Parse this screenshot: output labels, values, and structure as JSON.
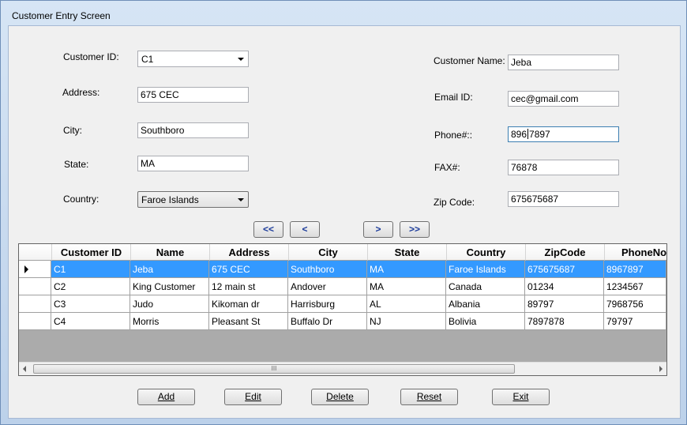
{
  "window": {
    "title": "Customer Entry Screen"
  },
  "form": {
    "customer_id": {
      "label": "Customer ID:",
      "value": "C1"
    },
    "address": {
      "label": "Address:",
      "value": "675 CEC"
    },
    "city": {
      "label": "City:",
      "value": "Southboro"
    },
    "state": {
      "label": "State:",
      "value": "MA"
    },
    "country": {
      "label": "Country:",
      "value": "Faroe Islands"
    },
    "customer_name": {
      "label": "Customer Name:",
      "value": "Jeba"
    },
    "email": {
      "label": "Email ID:",
      "value": "cec@gmail.com"
    },
    "phone": {
      "label": "Phone#::",
      "value_before_caret": "896",
      "value_after_caret": "7897"
    },
    "fax": {
      "label": "FAX#:",
      "value": "76878"
    },
    "zip": {
      "label": "Zip Code:",
      "value": "675675687"
    }
  },
  "nav": {
    "first": "<<",
    "prev": "<",
    "next": ">",
    "last": ">>"
  },
  "grid": {
    "columns": [
      "Customer ID",
      "Name",
      "Address",
      "City",
      "State",
      "Country",
      "ZipCode",
      "PhoneNo"
    ],
    "rows": [
      [
        "C1",
        "Jeba",
        "675 CEC",
        "Southboro",
        "MA",
        "Faroe Islands",
        "675675687",
        "8967897"
      ],
      [
        "C2",
        "King Customer",
        "12 main st",
        "Andover",
        "MA",
        "Canada",
        "01234",
        "1234567"
      ],
      [
        "C3",
        "Judo",
        "Kikoman dr",
        "Harrisburg",
        "AL",
        "Albania",
        "89797",
        "7968756"
      ],
      [
        "C4",
        "Morris",
        "Pleasant St",
        "Buffalo Dr",
        "NJ",
        "Bolivia",
        "7897878",
        "79797"
      ]
    ],
    "selected_row": 0,
    "scroll_thumb_grip": "III"
  },
  "buttons": {
    "add": "Add",
    "edit": "Edit",
    "delete": "Delete",
    "reset": "Reset",
    "exit": "Exit"
  },
  "colors": {
    "selection": "#3399ff",
    "grid_background": "#ababab",
    "nav_text": "#1a3a9a"
  },
  "icons": {
    "row_pointer": "row-pointer-icon",
    "combo_arrow": "dropdown-arrow-icon"
  }
}
